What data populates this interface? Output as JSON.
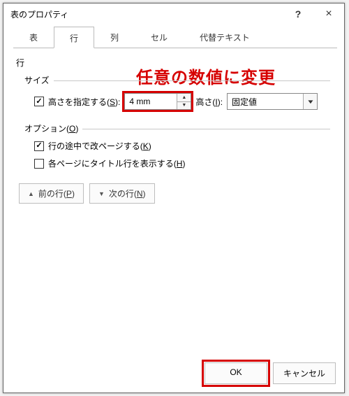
{
  "window": {
    "title": "表のプロパティ",
    "help_glyph": "?",
    "close_glyph": "×"
  },
  "tabs": [
    {
      "label": "表"
    },
    {
      "label": "行"
    },
    {
      "label": "列"
    },
    {
      "label": "セル"
    },
    {
      "label": "代替テキスト"
    }
  ],
  "active_tab_index": 1,
  "annotation": "任意の数値に変更",
  "row_panel": {
    "heading": "行",
    "size_group": {
      "legend": "サイズ",
      "specify_height": {
        "checked": true,
        "label_pre": "高さを指定する(",
        "label_key": "S",
        "label_post": "):"
      },
      "height_value": "4 mm",
      "height_label_pre": "高さ(",
      "height_label_key": "I",
      "height_label_post": "):",
      "height_rule_value": "固定値"
    },
    "options_group": {
      "legend_pre": "オプション(",
      "legend_key": "O",
      "legend_post": ")",
      "allow_break": {
        "checked": true,
        "label_pre": "行の途中で改ページする(",
        "label_key": "K",
        "label_post": ")"
      },
      "repeat_header": {
        "checked": false,
        "label_pre": "各ページにタイトル行を表示する(",
        "label_key": "H",
        "label_post": ")"
      }
    },
    "nav": {
      "prev_glyph": "▲",
      "prev_pre": "前の行(",
      "prev_key": "P",
      "prev_post": ")",
      "next_glyph": "▼",
      "next_pre": "次の行(",
      "next_key": "N",
      "next_post": ")"
    }
  },
  "footer": {
    "ok": "OK",
    "cancel": "キャンセル"
  },
  "triangles": {
    "up": "▲",
    "down": "▼"
  }
}
